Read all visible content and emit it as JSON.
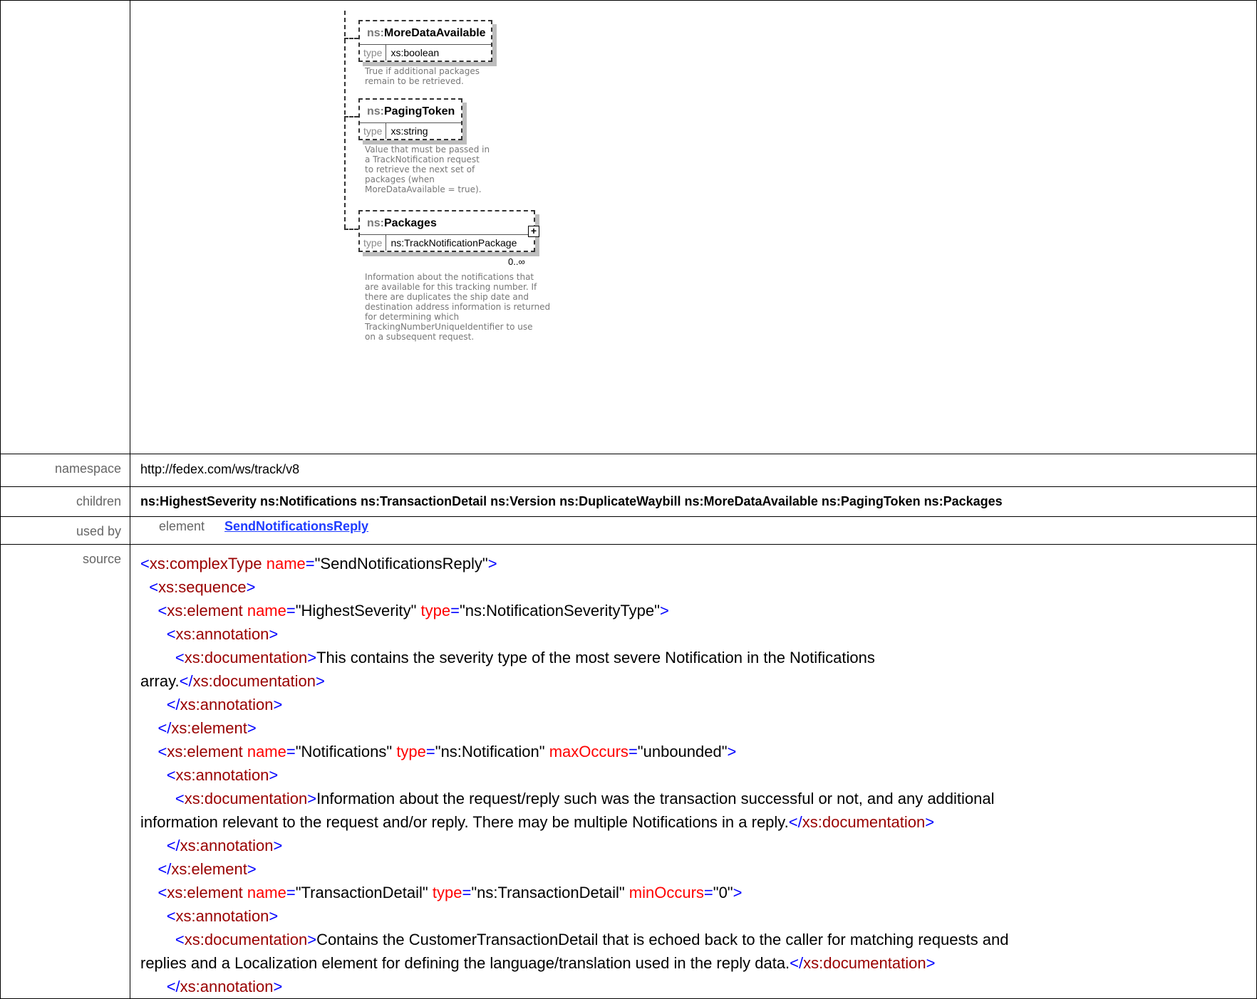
{
  "diagram": {
    "elements": [
      {
        "prefix": "ns:",
        "name": "MoreDataAvailable",
        "type_label": "type",
        "type": "xs:boolean",
        "doc": "True if additional packages\nremain to be retrieved."
      },
      {
        "prefix": "ns:",
        "name": "PagingToken",
        "type_label": "type",
        "type": "xs:string",
        "doc": "Value that must be passed in\na TrackNotification request\nto retrieve the next set of\npackages (when\nMoreDataAvailable = true)."
      },
      {
        "prefix": "ns:",
        "name": "Packages",
        "type_label": "type",
        "type": "ns:TrackNotificationPackage",
        "cardinality": "0..∞",
        "doc": "Information about the notifications that\nare available for this tracking number. If\nthere are duplicates the ship date and\ndestination address information is returned\nfor determining which\nTrackingNumberUniqueIdentifier to use\non a subsequent request."
      }
    ]
  },
  "rows": {
    "namespace": {
      "label": "namespace",
      "value": "http://fedex.com/ws/track/v8"
    },
    "children": {
      "label": "children",
      "value": "ns:HighestSeverity ns:Notifications ns:TransactionDetail ns:Version ns:DuplicateWaybill ns:MoreDataAvailable ns:PagingToken ns:Packages"
    },
    "used_by": {
      "label": "used by",
      "kind": "element",
      "link": "SendNotificationsReply"
    },
    "source": {
      "label": "source"
    }
  },
  "source": {
    "l1": {
      "tag": "xs:complexType",
      "attr": "name",
      "val": "\"SendNotificationsReply\""
    },
    "l2": {
      "tag": "xs:sequence"
    },
    "e1": {
      "tag": "xs:element",
      "a1": "name",
      "v1": "\"HighestSeverity\"",
      "a2": "type",
      "v2": "\"ns:NotificationSeverityType\""
    },
    "ann": "xs:annotation",
    "doc": "xs:documentation",
    "elem": "xs:element",
    "d1": "This contains the severity type of the most severe Notification in the Notifications\narray.",
    "e2": {
      "tag": "xs:element",
      "a1": "name",
      "v1": "\"Notifications\"",
      "a2": "type",
      "v2": "\"ns:Notification\"",
      "a3": "maxOccurs",
      "v3": "\"unbounded\""
    },
    "d2": "Information about the request/reply such was the transaction successful or not, and any additional\ninformation relevant to the request and/or reply. There may be multiple Notifications in a reply.",
    "e3": {
      "tag": "xs:element",
      "a1": "name",
      "v1": "\"TransactionDetail\"",
      "a2": "type",
      "v2": "\"ns:TransactionDetail\"",
      "a3": "minOccurs",
      "v3": "\"0\""
    },
    "d3": "Contains the CustomerTransactionDetail that is echoed back to the caller for matching requests and\nreplies and a Localization element for defining the language/translation used in the reply data."
  }
}
